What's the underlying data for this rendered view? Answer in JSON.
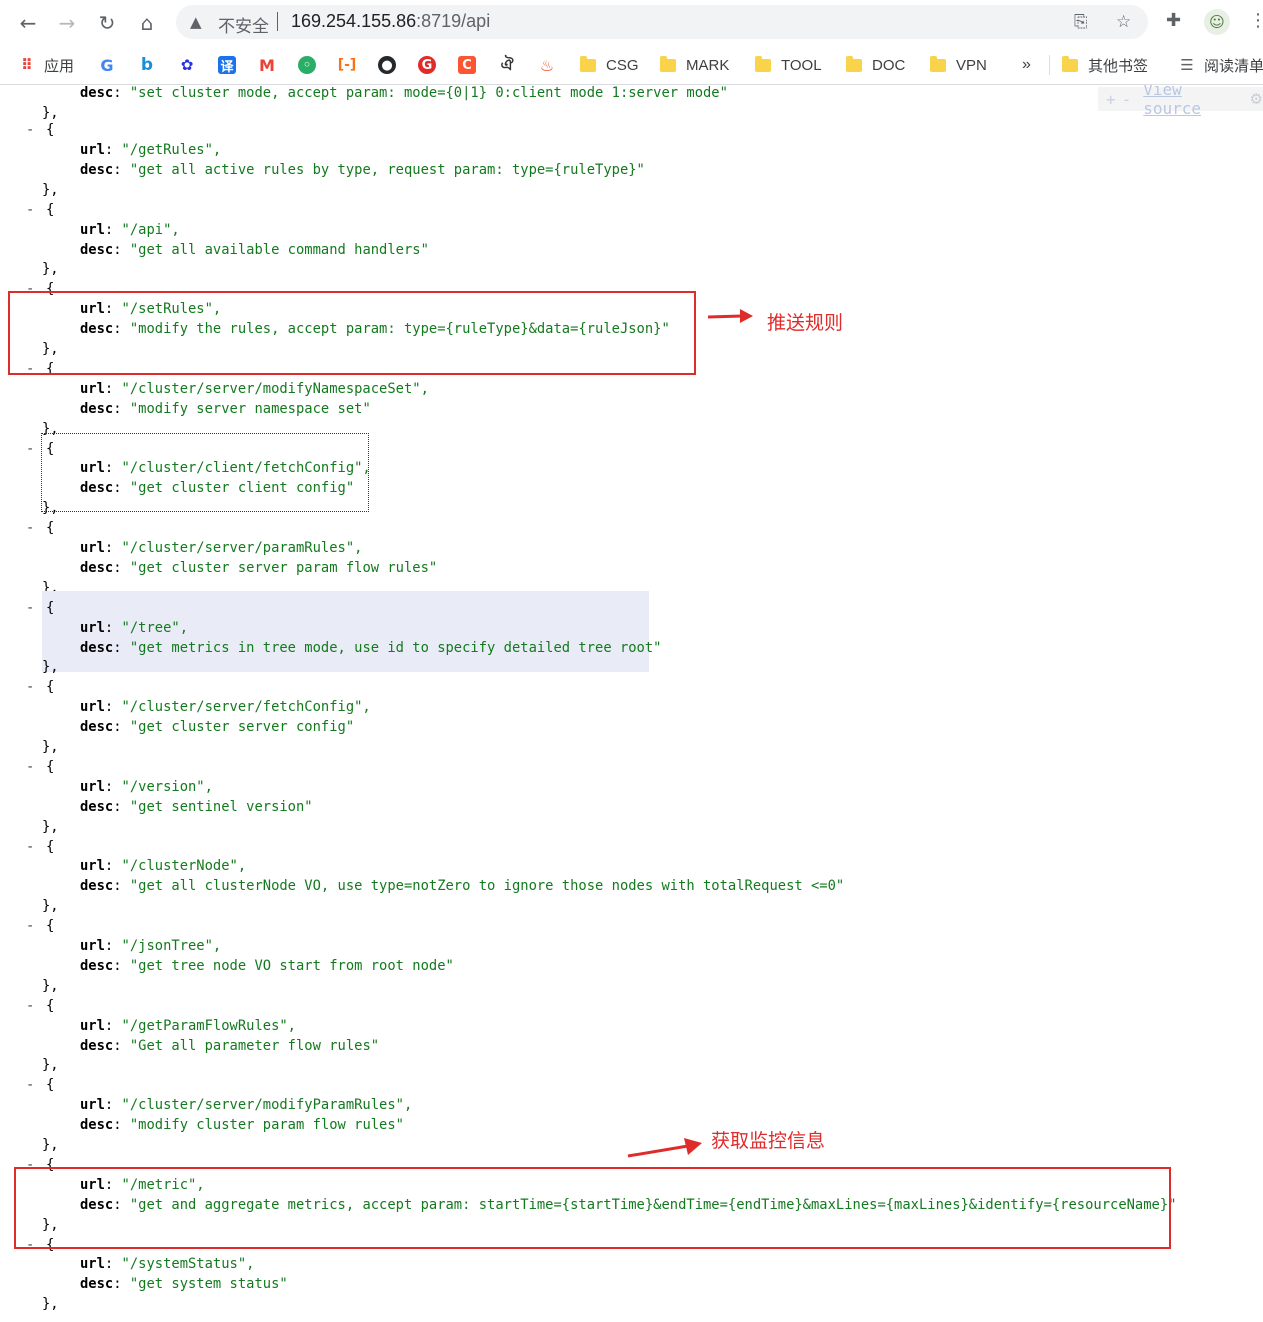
{
  "browser": {
    "url_warning": "不安全",
    "url_host": "169.254.155.86",
    "url_rest": ":8719/api",
    "bookmarks": {
      "apps": "应用",
      "folders": [
        "CSG",
        "MARK",
        "TOOL",
        "DOC",
        "VPN"
      ],
      "more": "»",
      "other": "其他书签",
      "reading": "阅读清单"
    }
  },
  "viewer": {
    "view_source": "View source",
    "partial_top": {
      "url": "\"/setClusterMode\",",
      "desc": "\"set cluster mode, accept param: mode={0|1} 0:client mode 1:server mode\""
    },
    "entries": [
      {
        "url": "\"/getRules\",",
        "desc": "\"get all active rules by type, request param: type={ruleType}\""
      },
      {
        "url": "\"/api\",",
        "desc": "\"get all available command handlers\""
      },
      {
        "url": "\"/setRules\",",
        "desc": "\"modify the rules, accept param: type={ruleType}&data={ruleJson}\""
      },
      {
        "url": "\"/cluster/server/modifyNamespaceSet\",",
        "desc": "\"modify server namespace set\""
      },
      {
        "url": "\"/cluster/client/fetchConfig\",",
        "desc": "\"get cluster client config\""
      },
      {
        "url": "\"/cluster/server/paramRules\",",
        "desc": "\"get cluster server param flow rules\""
      },
      {
        "url": "\"/tree\",",
        "desc": "\"get metrics in tree mode, use id to specify detailed tree root\""
      },
      {
        "url": "\"/cluster/server/fetchConfig\",",
        "desc": "\"get cluster server config\""
      },
      {
        "url": "\"/version\",",
        "desc": "\"get sentinel version\""
      },
      {
        "url": "\"/clusterNode\",",
        "desc": "\"get all clusterNode VO, use type=notZero to ignore those nodes with totalRequest <=0\""
      },
      {
        "url": "\"/jsonTree\",",
        "desc": "\"get tree node VO start from root node\""
      },
      {
        "url": "\"/getParamFlowRules\",",
        "desc": "\"Get all parameter flow rules\""
      },
      {
        "url": "\"/cluster/server/modifyParamRules\",",
        "desc": "\"modify cluster param flow rules\""
      },
      {
        "url": "\"/metric\",",
        "desc": "\"get and aggregate metrics, accept param: startTime={startTime}&endTime={endTime}&maxLines={maxLines}&identify={resourceName}\""
      },
      {
        "url": "\"/systemStatus\",",
        "desc": "\"get system status\""
      }
    ]
  },
  "annotations": {
    "push_rules": "推送规则",
    "get_metrics": "获取监控信息",
    "color": "#e02b2b"
  }
}
